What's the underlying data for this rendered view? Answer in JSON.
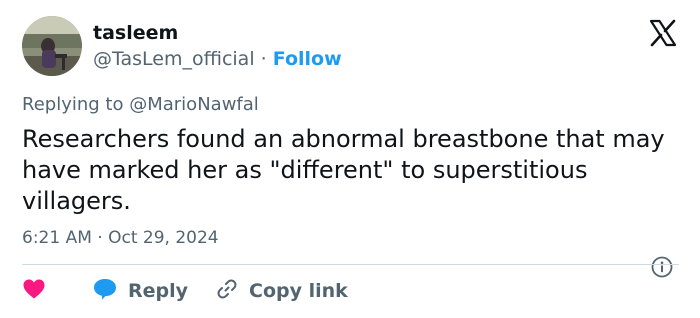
{
  "user": {
    "display_name": "tasleem",
    "handle": "@TasLem_official",
    "separator": "·",
    "follow_label": "Follow"
  },
  "reply_context": {
    "prefix": "Replying to",
    "mention": "@MarioNawfal"
  },
  "tweet": {
    "text": "Researchers found an abnormal breastbone that may have marked her as \"different\" to superstitious villagers.",
    "timestamp": "6:21 AM · Oct 29, 2024"
  },
  "actions": {
    "reply_label": "Reply",
    "copy_link_label": "Copy link"
  },
  "icons": {
    "brand": "x-logo-icon",
    "info": "info-icon",
    "like": "heart-icon",
    "reply": "speech-bubble-icon",
    "copy": "link-icon"
  },
  "colors": {
    "text": "#0f1419",
    "secondary": "#536471",
    "accent": "#1d9bf0",
    "like": "#f91880",
    "divider": "#cfd9de"
  }
}
